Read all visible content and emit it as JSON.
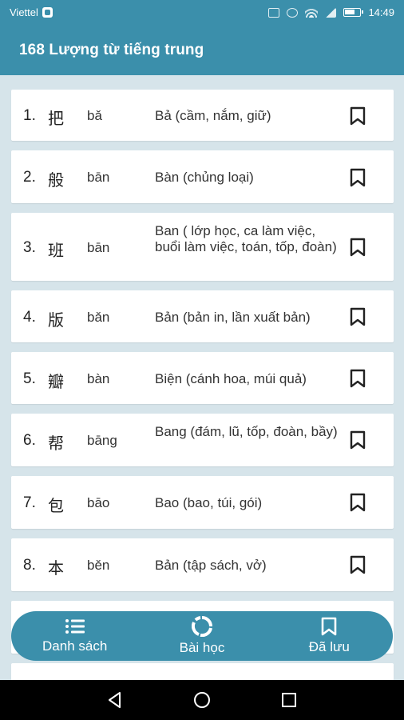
{
  "status_bar": {
    "carrier": "Viettel",
    "time": "14:49"
  },
  "app_bar": {
    "title": "168 Lượng từ tiếng trung"
  },
  "entries": [
    {
      "num": "1.",
      "hanzi": "把",
      "pinyin": "bǎ",
      "meaning": "Bả (cầm, nắm, giữ)"
    },
    {
      "num": "2.",
      "hanzi": "般",
      "pinyin": "bān",
      "meaning": "Bàn (chủng loại)"
    },
    {
      "num": "3.",
      "hanzi": "班",
      "pinyin": "bān",
      "meaning": "Ban ( lớp học, ca làm việc, buổi làm việc, toán, tốp, đoàn)"
    },
    {
      "num": "4.",
      "hanzi": "版",
      "pinyin": "bǎn",
      "meaning": "Bản (bản in, lần xuất bản)"
    },
    {
      "num": "5.",
      "hanzi": "瓣",
      "pinyin": "bàn",
      "meaning": "Biện (cánh hoa, múi quả)"
    },
    {
      "num": "6.",
      "hanzi": "帮",
      "pinyin": "bāng",
      "meaning": "Bang (đám, lũ, tốp, đoàn, bầy)"
    },
    {
      "num": "7.",
      "hanzi": "包",
      "pinyin": "bāo",
      "meaning": "Bao (bao, túi, gói)"
    },
    {
      "num": "8.",
      "hanzi": "本",
      "pinyin": "běn",
      "meaning": "Bản (tập sách, vở)"
    }
  ],
  "bottom_nav": {
    "list_label": "Danh sách",
    "lessons_label": "Bài học",
    "saved_label": "Đã lưu"
  },
  "colors": {
    "primary": "#3b8fab",
    "background": "#d6e4ea"
  }
}
